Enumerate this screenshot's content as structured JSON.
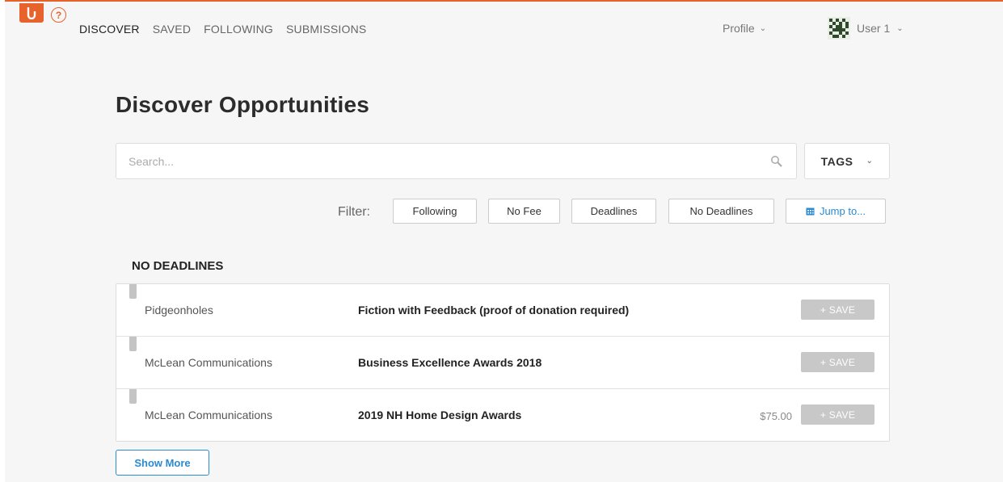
{
  "colors": {
    "brand": "#e8632b",
    "link": "#2a8ad2",
    "save_button": "#c8c8c8"
  },
  "nav": {
    "items": [
      {
        "label": "DISCOVER",
        "active": true
      },
      {
        "label": "SAVED",
        "active": false
      },
      {
        "label": "FOLLOWING",
        "active": false
      },
      {
        "label": "SUBMISSIONS",
        "active": false
      }
    ],
    "profile_label": "Profile",
    "user_label": "User 1"
  },
  "page": {
    "title": "Discover Opportunities"
  },
  "search": {
    "placeholder": "Search...",
    "value": ""
  },
  "tags": {
    "label": "TAGS"
  },
  "filter": {
    "label": "Filter:",
    "buttons": [
      "Following",
      "No Fee",
      "Deadlines",
      "No Deadlines"
    ],
    "jump_label": "Jump to..."
  },
  "section": {
    "title": "NO DEADLINES"
  },
  "opportunities": [
    {
      "org": "Pidgeonholes",
      "name": "Fiction with Feedback (proof of donation required)",
      "fee": "",
      "save_label": "+ SAVE"
    },
    {
      "org": "McLean Communications",
      "name": "Business Excellence Awards 2018",
      "fee": "",
      "save_label": "+ SAVE"
    },
    {
      "org": "McLean Communications",
      "name": "2019 NH Home Design Awards",
      "fee": "$75.00",
      "save_label": "+ SAVE"
    }
  ],
  "show_more_label": "Show More",
  "icons": [
    "submittable-logo-icon",
    "help-icon",
    "chevron-down-icon",
    "avatar",
    "search-icon",
    "calendar-icon",
    "bookmark-flag-icon"
  ]
}
